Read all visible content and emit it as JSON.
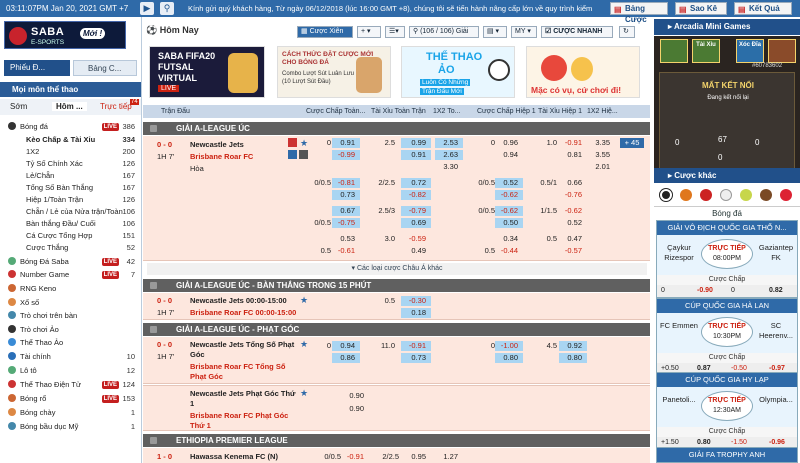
{
  "topbar": {
    "time": "03:11:07PM Jan 20, 2021 GMT +7",
    "news": "Kính gửi quý khách hàng, Từ ngày 06/12/2018 (lúc 16:00 GMT +8), chúng tôi sẽ tiến hành nâng cấp lớn về quy trình kiểm",
    "buttons": [
      "Bảng Cược",
      "Sao Kê",
      "Kết Quả"
    ]
  },
  "left": {
    "logo": {
      "brand": "SABA",
      "sub": "E-SPORTS",
      "badge": "Mới !"
    },
    "tabs": [
      "Phiếu Đ...",
      "Bảng C..."
    ],
    "section_title": "Mọi môn thể thao",
    "subtabs": [
      "Sớm",
      "Hôm ...",
      "Trực tiếp"
    ],
    "subtab_badge": "74",
    "items": [
      {
        "label": "Bóng đá",
        "live": "LIVE",
        "count": "386"
      },
      {
        "label": "Kèo Chấp & Tài Xỉu",
        "count": "334"
      },
      {
        "label": "1X2",
        "count": "200"
      },
      {
        "label": "Tỷ Số Chính Xác",
        "count": "126"
      },
      {
        "label": "Lẻ/Chẵn",
        "count": "167"
      },
      {
        "label": "Tổng Số Bàn Thắng",
        "count": "167"
      },
      {
        "label": "Hiệp 1/Toàn Trận",
        "count": "126"
      },
      {
        "label": "Chẵn / Lẻ của Nửa trận/Toàn",
        "count": "106"
      },
      {
        "label": "Bàn thắng Đầu/ Cuối",
        "count": "106"
      },
      {
        "label": "Cá Cược Tổng Hợp",
        "count": "151"
      },
      {
        "label": "Cược Thắng",
        "count": "52"
      },
      {
        "label": "Bóng Đá Saba",
        "live": "LIVE",
        "count": "42"
      },
      {
        "label": "Number Game",
        "live": "LIVE",
        "count": "7"
      },
      {
        "label": "RNG Keno",
        "count": ""
      },
      {
        "label": "Xổ số",
        "count": ""
      },
      {
        "label": "Trò chơi trên bàn",
        "count": ""
      },
      {
        "label": "Trò chơi Ảo",
        "count": ""
      },
      {
        "label": "Thể Thao Ảo",
        "count": ""
      },
      {
        "label": "Tài chính",
        "count": "10"
      },
      {
        "label": "Lô tô",
        "count": "12"
      },
      {
        "label": "Thể Thao Điện Tử",
        "live": "LIVE",
        "count": "124"
      },
      {
        "label": "Bóng rổ",
        "live": "LIVE",
        "count": "153"
      },
      {
        "label": "Bóng chày",
        "count": "1"
      },
      {
        "label": "Bóng bầu dục Mỹ",
        "count": "1"
      }
    ]
  },
  "center": {
    "title": "Hôm Nay",
    "controls": {
      "bet_type": "Cược Xiên",
      "count": "(106 / 106) Giải",
      "odds": "MY",
      "quick": "CƯỢC NHANH"
    },
    "banners": [
      {
        "line1": "SABA FIFA20",
        "line2": "FUTSAL",
        "line3": "VIRTUAL",
        "badge": "LIVE"
      },
      {
        "line1": "CÁCH THỨC ĐẶT CƯỢC MỚI",
        "line2": "CHO BÓNG ĐÁ",
        "line3": "Combo Lượt Sút Luân Lưu",
        "line4": "(10 Lượt Sút Đầu)"
      },
      {
        "line1": "THỂ THAO",
        "line2": "ẢO",
        "line3": "Luôn Có Những",
        "line4": "Trận Đấu Mới"
      },
      {
        "line1": "Mặc có vụ, cứ chơi đi!"
      }
    ],
    "columns": [
      "Trận Đấu",
      "Cược Chấp Toàn...",
      "Tài Xỉu Toàn Trận",
      "1X2 To...",
      "Cược Chấp Hiệp 1",
      "Tài Xỉu Hiệp 1",
      "1X2 Hiệ..."
    ],
    "leagues": [
      {
        "name": "GIẢI A-LEAGUE ÚC",
        "home": "Newcastle Jets",
        "away": "Brisbane Roar FC",
        "draw": "Hòa",
        "score": "0 - 0",
        "time": "1H 7'",
        "more_bets": "+ 45",
        "rows": [
          [
            "0",
            "0.91",
            "2.5",
            "0.99",
            "2.53",
            "0",
            "0.96",
            "1.0",
            "-0.91",
            "3.35"
          ],
          [
            "",
            "-0.99",
            "",
            "0.91",
            "2.63",
            "",
            "0.94",
            "",
            "0.81",
            "3.55"
          ],
          [
            "",
            "",
            "",
            "",
            "3.30",
            "",
            "",
            "",
            "",
            "2.01"
          ],
          [
            "0/0.5",
            "-0.81",
            "2/2.5",
            "0.72",
            "",
            "0/0.5",
            "0.52",
            "0.5/1",
            "0.66",
            ""
          ],
          [
            "",
            "0.73",
            "",
            "-0.82",
            "",
            "",
            "-0.62",
            "",
            "-0.76",
            ""
          ],
          [
            "",
            "0.67",
            "2.5/3",
            "-0.79",
            "",
            "0/0.5",
            "-0.62",
            "1/1.5",
            "-0.62",
            ""
          ],
          [
            "0/0.5",
            "-0.75",
            "",
            "0.69",
            "",
            "",
            "0.50",
            "",
            "0.52",
            ""
          ],
          [
            "",
            "0.53",
            "3.0",
            "-0.59",
            "",
            "",
            "0.34",
            "0.5",
            "0.47",
            ""
          ],
          [
            "0.5",
            "-0.61",
            "",
            "0.49",
            "",
            "0.5",
            "-0.44",
            "",
            "-0.57",
            ""
          ]
        ],
        "more_label": "Các loại cược Châu Á khác"
      },
      {
        "name": "GIẢI A-LEAGUE ÚC - BÀN THẮNG TRONG 15 PHÚT",
        "home": "Newcastle Jets 00:00-15:00",
        "away": "Brisbane Roar FC 00:00-15:00",
        "score": "0 - 0",
        "time": "1H 7'",
        "rows": [
          [
            "0.5",
            "-0.30"
          ],
          [
            "",
            "0.18"
          ]
        ]
      },
      {
        "name": "GIẢI A-LEAGUE ÚC - PHẠT GÓC",
        "home1": "Newcastle Jets Tổng Số Phạt",
        "home2": "Góc",
        "away1": "Brisbane Roar FC Tổng Số",
        "away2": "Phạt Góc",
        "score": "0 - 0",
        "time": "1H 7'",
        "rows": [
          [
            "0",
            "0.94",
            "11.0",
            "-0.91",
            "0",
            "-1.00",
            "4.5",
            "0.92"
          ],
          [
            "",
            "0.86",
            "",
            "0.73",
            "",
            "0.80",
            "",
            "0.80"
          ]
        ]
      },
      {
        "name": "",
        "home1": "Newcastle Jets Phạt Góc Thứ",
        "home2": "1",
        "away1": "Brisbane Roar FC Phạt Góc",
        "away2": "Thứ 1",
        "rows": [
          [
            "0.90"
          ],
          [
            "0.90"
          ]
        ]
      },
      {
        "name": "ETHIOPIA PREMIER LEAGUE",
        "home": "Hawassa Kenema FC (N)",
        "score": "1 - 0",
        "rows": [
          [
            "0/0.5",
            "-0.91",
            "2/2.5",
            "0.95",
            "1.27"
          ]
        ]
      }
    ]
  },
  "right": {
    "mini_title": "Arcadia Mini Games",
    "mini_games": [
      "Tài Xỉu",
      "Xóc Đĩa"
    ],
    "mini_id": "#60783602",
    "mini_msg": "MẤT KẾT NỐI",
    "mini_sub": "Đang kết nối lại",
    "mini_nums": [
      "0",
      "67",
      "0",
      "0"
    ],
    "bets_title": "Cược khác",
    "sport": "Bóng đá",
    "cards": [
      {
        "title": "GIẢI VÔ ĐỊCH QUỐC GIA THỔ N...",
        "home": "Çaykur Rizespor",
        "away": "Gaziantep FK",
        "status": "TRỰC TIẾP",
        "time": "08:00PM",
        "label": "Cược Chấp",
        "odds": [
          "0",
          "-0.90",
          "0",
          "0.82"
        ]
      },
      {
        "title": "CÚP QUỐC GIA HÀ LAN",
        "home": "FC Emmen",
        "away": "SC Heerenv...",
        "status": "TRỰC TIẾP",
        "time": "10:30PM",
        "label": "Cược Chấp",
        "odds": [
          "+0.50",
          "0.87",
          "-0.50",
          "-0.97"
        ]
      },
      {
        "title": "CÚP QUỐC GIA HY LẠP",
        "home": "Panetoli...",
        "away": "Olympia...",
        "status": "TRỰC TIẾP",
        "time": "12:30AM",
        "label": "Cược Chấp",
        "odds": [
          "+1.50",
          "0.80",
          "-1.50",
          "-0.96"
        ]
      },
      {
        "title": "GIẢI FA TROPHY ANH"
      }
    ]
  }
}
